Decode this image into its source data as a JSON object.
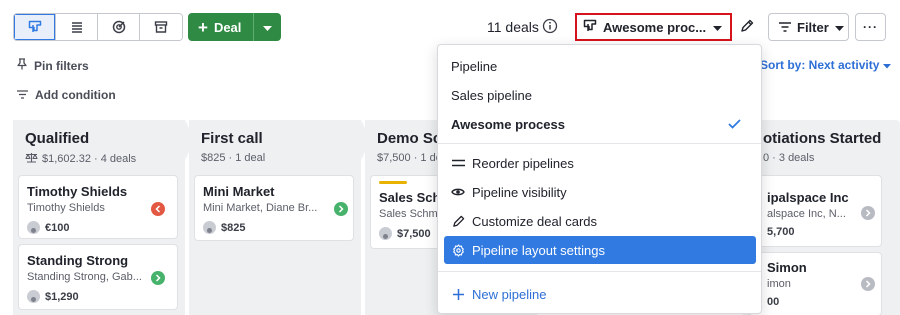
{
  "toolbar": {
    "views": [
      {
        "name": "pipeline-view",
        "active": true
      },
      {
        "name": "list-view",
        "active": false
      },
      {
        "name": "forecast-view",
        "active": false
      },
      {
        "name": "archive-view",
        "active": false
      }
    ],
    "deal_button_label": "Deal",
    "deal_count": "11 deals",
    "pipeline_selected": "Awesome proc...",
    "filter_label": "Filter",
    "more_label": "···"
  },
  "filters": {
    "pin_filters": "Pin filters",
    "add_condition": "Add condition",
    "sort_by": "Sort by: Next activity"
  },
  "stages": [
    {
      "title": "Qualified",
      "meta": "$1,602.32 · 4 deals",
      "cards": [
        {
          "title": "Timothy Shields",
          "sub": "Timothy Shields",
          "value": "€100",
          "status": "red"
        },
        {
          "title": "Standing Strong",
          "sub": "Standing Strong, Gab...",
          "value": "$1,290",
          "status": "green"
        }
      ]
    },
    {
      "title": "First call",
      "meta": "$825 · 1 deal",
      "cards": [
        {
          "title": "Mini Market",
          "sub": "Mini Market, Diane Br...",
          "value": "$825",
          "status": "green"
        }
      ]
    },
    {
      "title": "Demo Sch",
      "meta": "$7,500 · 1 de",
      "cards": [
        {
          "title": "Sales Schr",
          "sub": "Sales Schma",
          "value": "$7,500",
          "status": ""
        }
      ]
    },
    {
      "title": "otiations Started",
      "meta": "0 · 3 deals",
      "cards": [
        {
          "title": "ipalspace Inc",
          "sub": "alspace Inc, N...",
          "value": "5,700",
          "status": "grey"
        },
        {
          "title": "Simon",
          "sub": "imon",
          "value": "00",
          "status": "grey"
        }
      ]
    }
  ],
  "dropdown": {
    "pipelines": [
      {
        "label": "Pipeline",
        "selected": false
      },
      {
        "label": "Sales pipeline",
        "selected": false
      },
      {
        "label": "Awesome process",
        "selected": true
      }
    ],
    "actions": [
      {
        "label": "Reorder pipelines",
        "icon": "reorder-icon"
      },
      {
        "label": "Pipeline visibility",
        "icon": "eye-icon"
      },
      {
        "label": "Customize deal cards",
        "icon": "pencil-icon"
      },
      {
        "label": "Pipeline layout settings",
        "icon": "gear-icon",
        "highlighted": true
      }
    ],
    "new_pipeline": "New pipeline"
  },
  "colors": {
    "accent": "#317ae2",
    "deal_green": "#2f8a43",
    "highlight_border": "#d6131a",
    "link_blue": "#2d6fd6"
  }
}
